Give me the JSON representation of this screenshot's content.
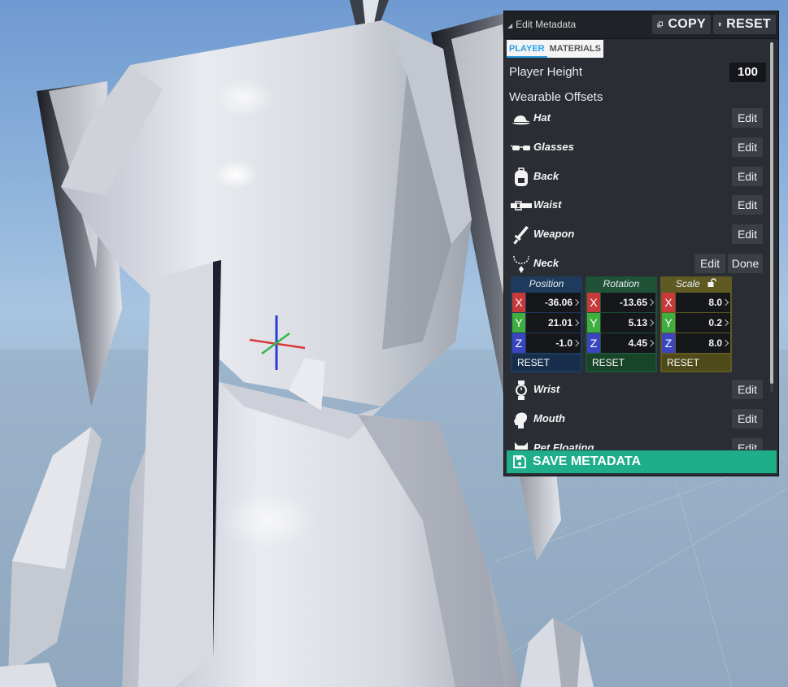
{
  "panel": {
    "title": "Edit Metadata",
    "copy_label": "COPY",
    "reset_label": "RESET",
    "tabs": [
      {
        "label": "PLAYER",
        "active": true
      },
      {
        "label": "MATERIALS",
        "active": false
      }
    ],
    "player_height": {
      "label": "Player Height",
      "value": "100"
    },
    "wearable_offsets_label": "Wearable Offsets",
    "wearables": [
      {
        "label": "Hat",
        "icon": "cap-icon",
        "edit": "Edit"
      },
      {
        "label": "Glasses",
        "icon": "glasses-icon",
        "edit": "Edit"
      },
      {
        "label": "Back",
        "icon": "backpack-icon",
        "edit": "Edit"
      },
      {
        "label": "Waist",
        "icon": "belt-icon",
        "edit": "Edit"
      },
      {
        "label": "Weapon",
        "icon": "sword-icon",
        "edit": "Edit"
      },
      {
        "label": "Neck",
        "icon": "necklace-icon",
        "edit": "Edit",
        "done": "Done"
      },
      {
        "label": "Wrist",
        "icon": "watch-icon",
        "edit": "Edit"
      },
      {
        "label": "Mouth",
        "icon": "head-icon",
        "edit": "Edit"
      },
      {
        "label": "Pet Floating",
        "icon": "pet-icon",
        "edit": "Edit"
      }
    ],
    "transform": {
      "position": {
        "label": "Position",
        "x": "-36.06",
        "y": "21.01",
        "z": "-1.0",
        "reset": "RESET",
        "color": "#1e3a5c"
      },
      "rotation": {
        "label": "Rotation",
        "x": "-13.65",
        "y": "5.13",
        "z": "4.45",
        "reset": "RESET",
        "color": "#1f5236"
      },
      "scale": {
        "label": "Scale",
        "x": "8.0",
        "y": "0.2",
        "z": "8.0",
        "reset": "RESET",
        "color": "#5f5a22",
        "lock_icon": "unlock-icon"
      },
      "axis_labels": {
        "x": "X",
        "y": "Y",
        "z": "Z"
      }
    },
    "save_label": "SAVE METADATA"
  }
}
